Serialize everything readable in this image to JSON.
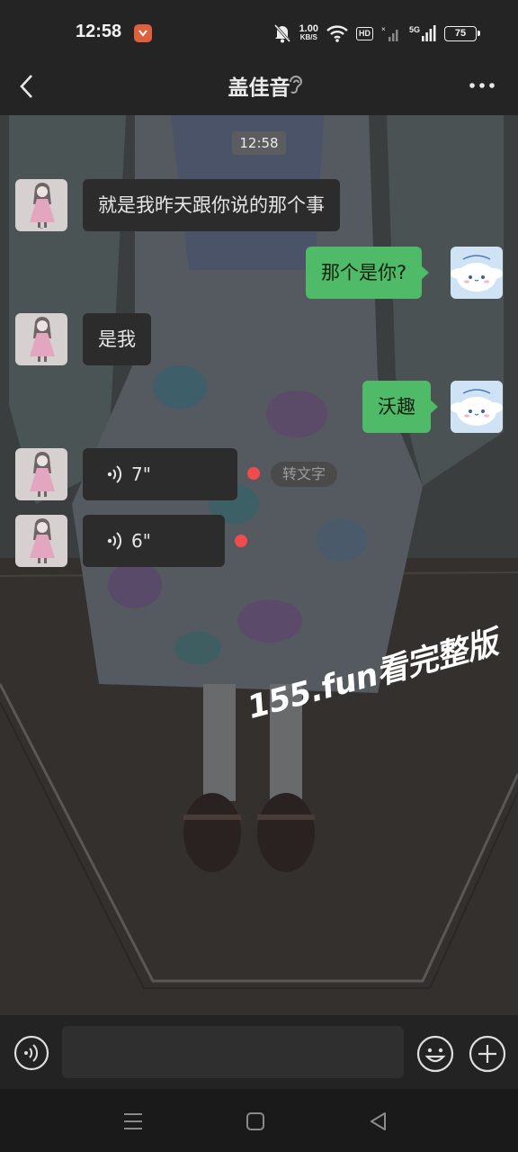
{
  "status_bar": {
    "time": "12:58",
    "net_speed_value": "1.00",
    "net_speed_unit": "KB/S",
    "hd_label": "HD",
    "network_type": "5G",
    "battery": "75",
    "icons": [
      "app-notification-icon",
      "silent-bell-icon",
      "wifi-icon",
      "hd-icon",
      "signal-icon",
      "battery-icon"
    ]
  },
  "header": {
    "title": "盖佳音",
    "back_icon": "chevron-left-icon",
    "ear_icon": "ear-icon",
    "more_icon": "more-dots-icon"
  },
  "chat": {
    "timestamp": "12:58",
    "messages": [
      {
        "side": "in",
        "type": "text",
        "text": "就是我昨天跟你说的那个事"
      },
      {
        "side": "out",
        "type": "text",
        "text": "那个是你?"
      },
      {
        "side": "in",
        "type": "text",
        "text": "是我"
      },
      {
        "side": "out",
        "type": "text",
        "text": "沃趣"
      },
      {
        "side": "in",
        "type": "voice",
        "duration": "7\"",
        "unread": true,
        "action": "转文字"
      },
      {
        "side": "in",
        "type": "voice",
        "duration": "6\"",
        "unread": true
      }
    ],
    "watermark": "155.fun看完整版"
  },
  "input_bar": {
    "placeholder": "",
    "icons": [
      "voice-mode-icon",
      "emoji-icon",
      "plus-icon"
    ]
  },
  "nav_bar": {
    "icons": [
      "menu-icon",
      "home-icon",
      "back-icon"
    ]
  },
  "colors": {
    "outgoing_bubble": "#4fbb68",
    "incoming_bubble": "#2c2c2c",
    "unread_dot": "#f24b4b"
  }
}
